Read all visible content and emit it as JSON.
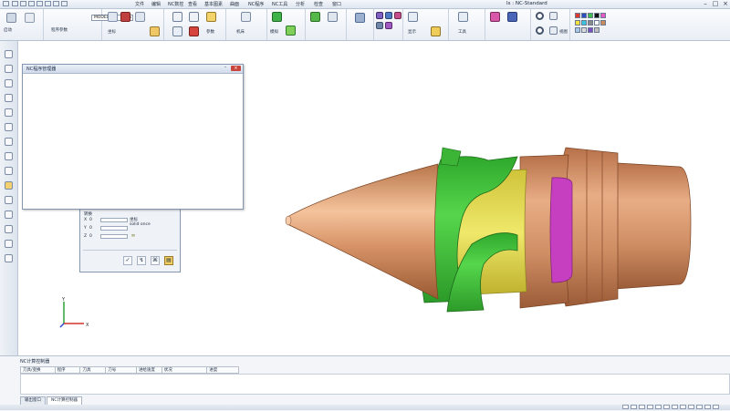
{
  "menubar": {
    "items": [
      "文件",
      "编辑",
      "NC数控",
      "查看",
      "基本图素",
      "曲面",
      "NC程序",
      "NC工具",
      "分析",
      "检查",
      "窗口"
    ],
    "title": "Is : NC-Standard"
  },
  "ribbon": {
    "model_select": "MODEL",
    "labels": {
      "new_program": "启动",
      "program_params": "程序参数",
      "coordinates": "坐标",
      "nc_params": "参数",
      "machine": "机床",
      "simulation": "模拟",
      "display": "显示",
      "tools": "工具",
      "view": "视图"
    }
  },
  "nc_dialog": {
    "title": "NC程序管理器"
  },
  "point_dialog": {
    "header": "转换",
    "mode": "坐标",
    "mode_value": "solid once",
    "x_label": "X",
    "x_value": "0",
    "y_label": "Y",
    "y_value": "0",
    "z_label": "Z",
    "z_value": "0"
  },
  "triad": {
    "y": "Y",
    "x": "X"
  },
  "output_panel": {
    "title": "NC计算控制器",
    "columns": [
      "刀具/变换",
      "程序",
      "刀具",
      "刀号",
      "进给速度",
      "状况",
      "进度"
    ],
    "tabs": [
      "输出窗口",
      "NC计算控制器"
    ]
  },
  "colors": {
    "copper": "#c98a5c",
    "green": "#3fc43a",
    "yellow": "#e3da4c",
    "magenta": "#c63fc0"
  }
}
